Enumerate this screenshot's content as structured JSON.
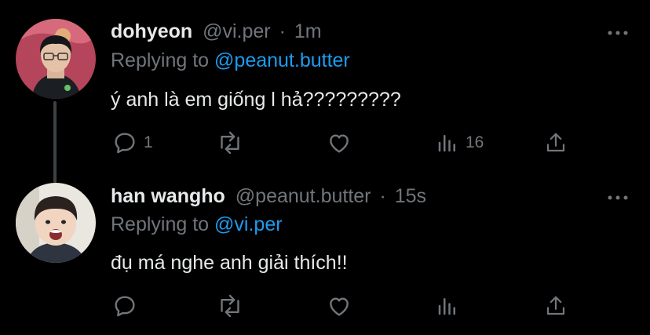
{
  "tweets": [
    {
      "name": "dohyeon",
      "handle": "@vi.per",
      "separator": "·",
      "time": "1m",
      "replying_prefix": "Replying to",
      "replying_handle": "@peanut.butter",
      "text": "ý anh là em giống l hả?????????",
      "reply_count": "1",
      "retweet_count": "",
      "like_count": "",
      "views_count": "16",
      "avatar_icon": "avatar-photo-dohyeon"
    },
    {
      "name": "han wangho",
      "handle": "@peanut.butter",
      "separator": "·",
      "time": "15s",
      "replying_prefix": "Replying to",
      "replying_handle": "@vi.per",
      "text": "đụ má nghe anh giải thích!!",
      "reply_count": "",
      "retweet_count": "",
      "like_count": "",
      "views_count": "",
      "avatar_icon": "avatar-photo-han-wangho"
    }
  ],
  "icons": {
    "more": "more-horizontal-icon",
    "reply": "reply-icon",
    "retweet": "retweet-icon",
    "like": "heart-icon",
    "views": "views-icon",
    "share": "share-icon"
  },
  "colors": {
    "background": "#000000",
    "text": "#e7e9ea",
    "secondary": "#71767b",
    "accent": "#1d9bf0",
    "thread_line": "#3e4144"
  }
}
